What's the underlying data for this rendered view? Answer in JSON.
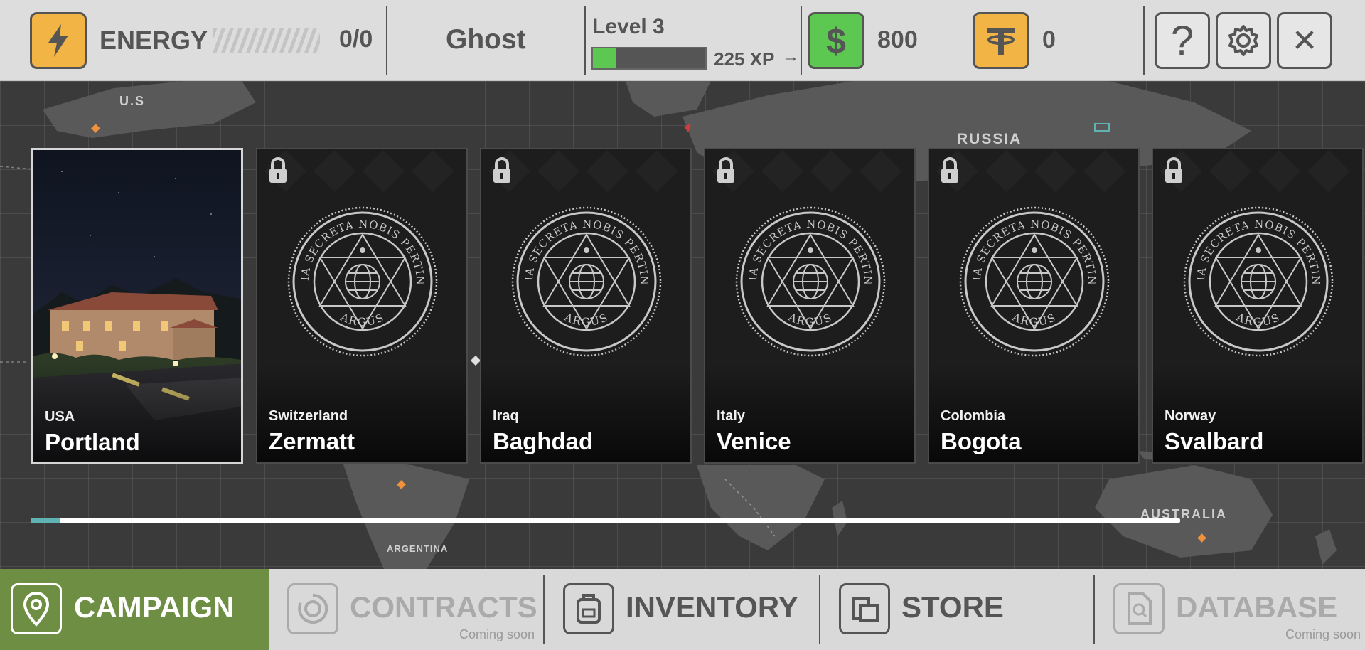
{
  "topbar": {
    "energy_label": "ENERGY",
    "energy_value": "0/0",
    "player_name": "Ghost",
    "level_label": "Level 3",
    "xp_text": "225 XP",
    "xp_arrow": "→",
    "xp_progress": 0.2,
    "cash_value": "800",
    "tether_value": "0",
    "help_symbol": "?",
    "close_symbol": "✕"
  },
  "map": {
    "labels": {
      "us": "U.S",
      "russia": "RUSSIA",
      "australia": "AUSTRALIA",
      "argentina": "ARGENTINA"
    }
  },
  "missions": [
    {
      "country": "USA",
      "city": "Portland",
      "locked": false
    },
    {
      "country": "Switzerland",
      "city": "Zermatt",
      "locked": true
    },
    {
      "country": "Iraq",
      "city": "Baghdad",
      "locked": true
    },
    {
      "country": "Italy",
      "city": "Venice",
      "locked": true
    },
    {
      "country": "Colombia",
      "city": "Bogota",
      "locked": true
    },
    {
      "country": "Norway",
      "city": "Svalbard",
      "locked": true
    }
  ],
  "seal": {
    "motto": "OMNIA SECRETA NOBIS PERTINENT",
    "name": "ARGUS"
  },
  "nav": {
    "campaign": "CAMPAIGN",
    "contracts": "CONTRACTS",
    "contracts_sub": "Coming soon",
    "inventory": "INVENTORY",
    "store": "STORE",
    "database": "DATABASE",
    "database_sub": "Coming soon"
  },
  "colors": {
    "accent_orange": "#f3b446",
    "accent_green": "#5cc851",
    "campaign_active": "#6e8f43",
    "topbar_bg": "#dddddd"
  },
  "icons": [
    "lightning-icon",
    "dollar-icon",
    "tether-icon",
    "help-icon",
    "gear-icon",
    "close-icon",
    "map-pin-icon",
    "contracts-icon",
    "backpack-icon",
    "store-icon",
    "database-icon",
    "lock-icon"
  ]
}
